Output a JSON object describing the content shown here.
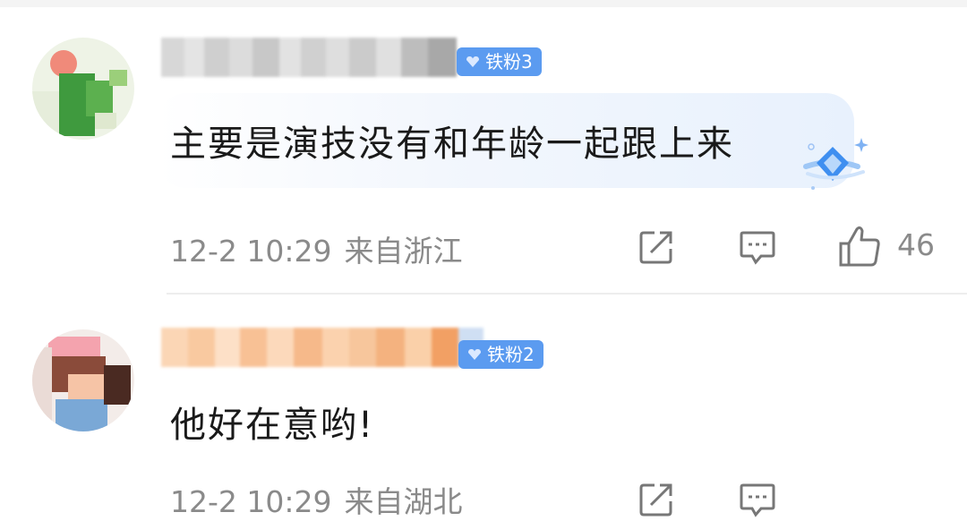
{
  "comments": [
    {
      "username_visible_fragment": "",
      "fan_badge": "铁粉3",
      "text": "主要是演技没有和年龄一起跟上来",
      "time": "12-2 10:29",
      "location": "来自浙江",
      "like_count": "46",
      "icons": [
        "share-icon",
        "reply-icon",
        "like-icon",
        "diamond-gem-icon"
      ]
    },
    {
      "username_visible_fragment": "",
      "fan_badge": "铁粉2",
      "text": "他好在意哟!",
      "time": "12-2 10:29",
      "location": "来自湖北",
      "icons": [
        "share-icon",
        "reply-icon"
      ]
    }
  ],
  "colors": {
    "badge_blue": "#5b9bf0",
    "meta_gray": "#8a8a8a",
    "bubble_blue": "#e8f1fd"
  }
}
